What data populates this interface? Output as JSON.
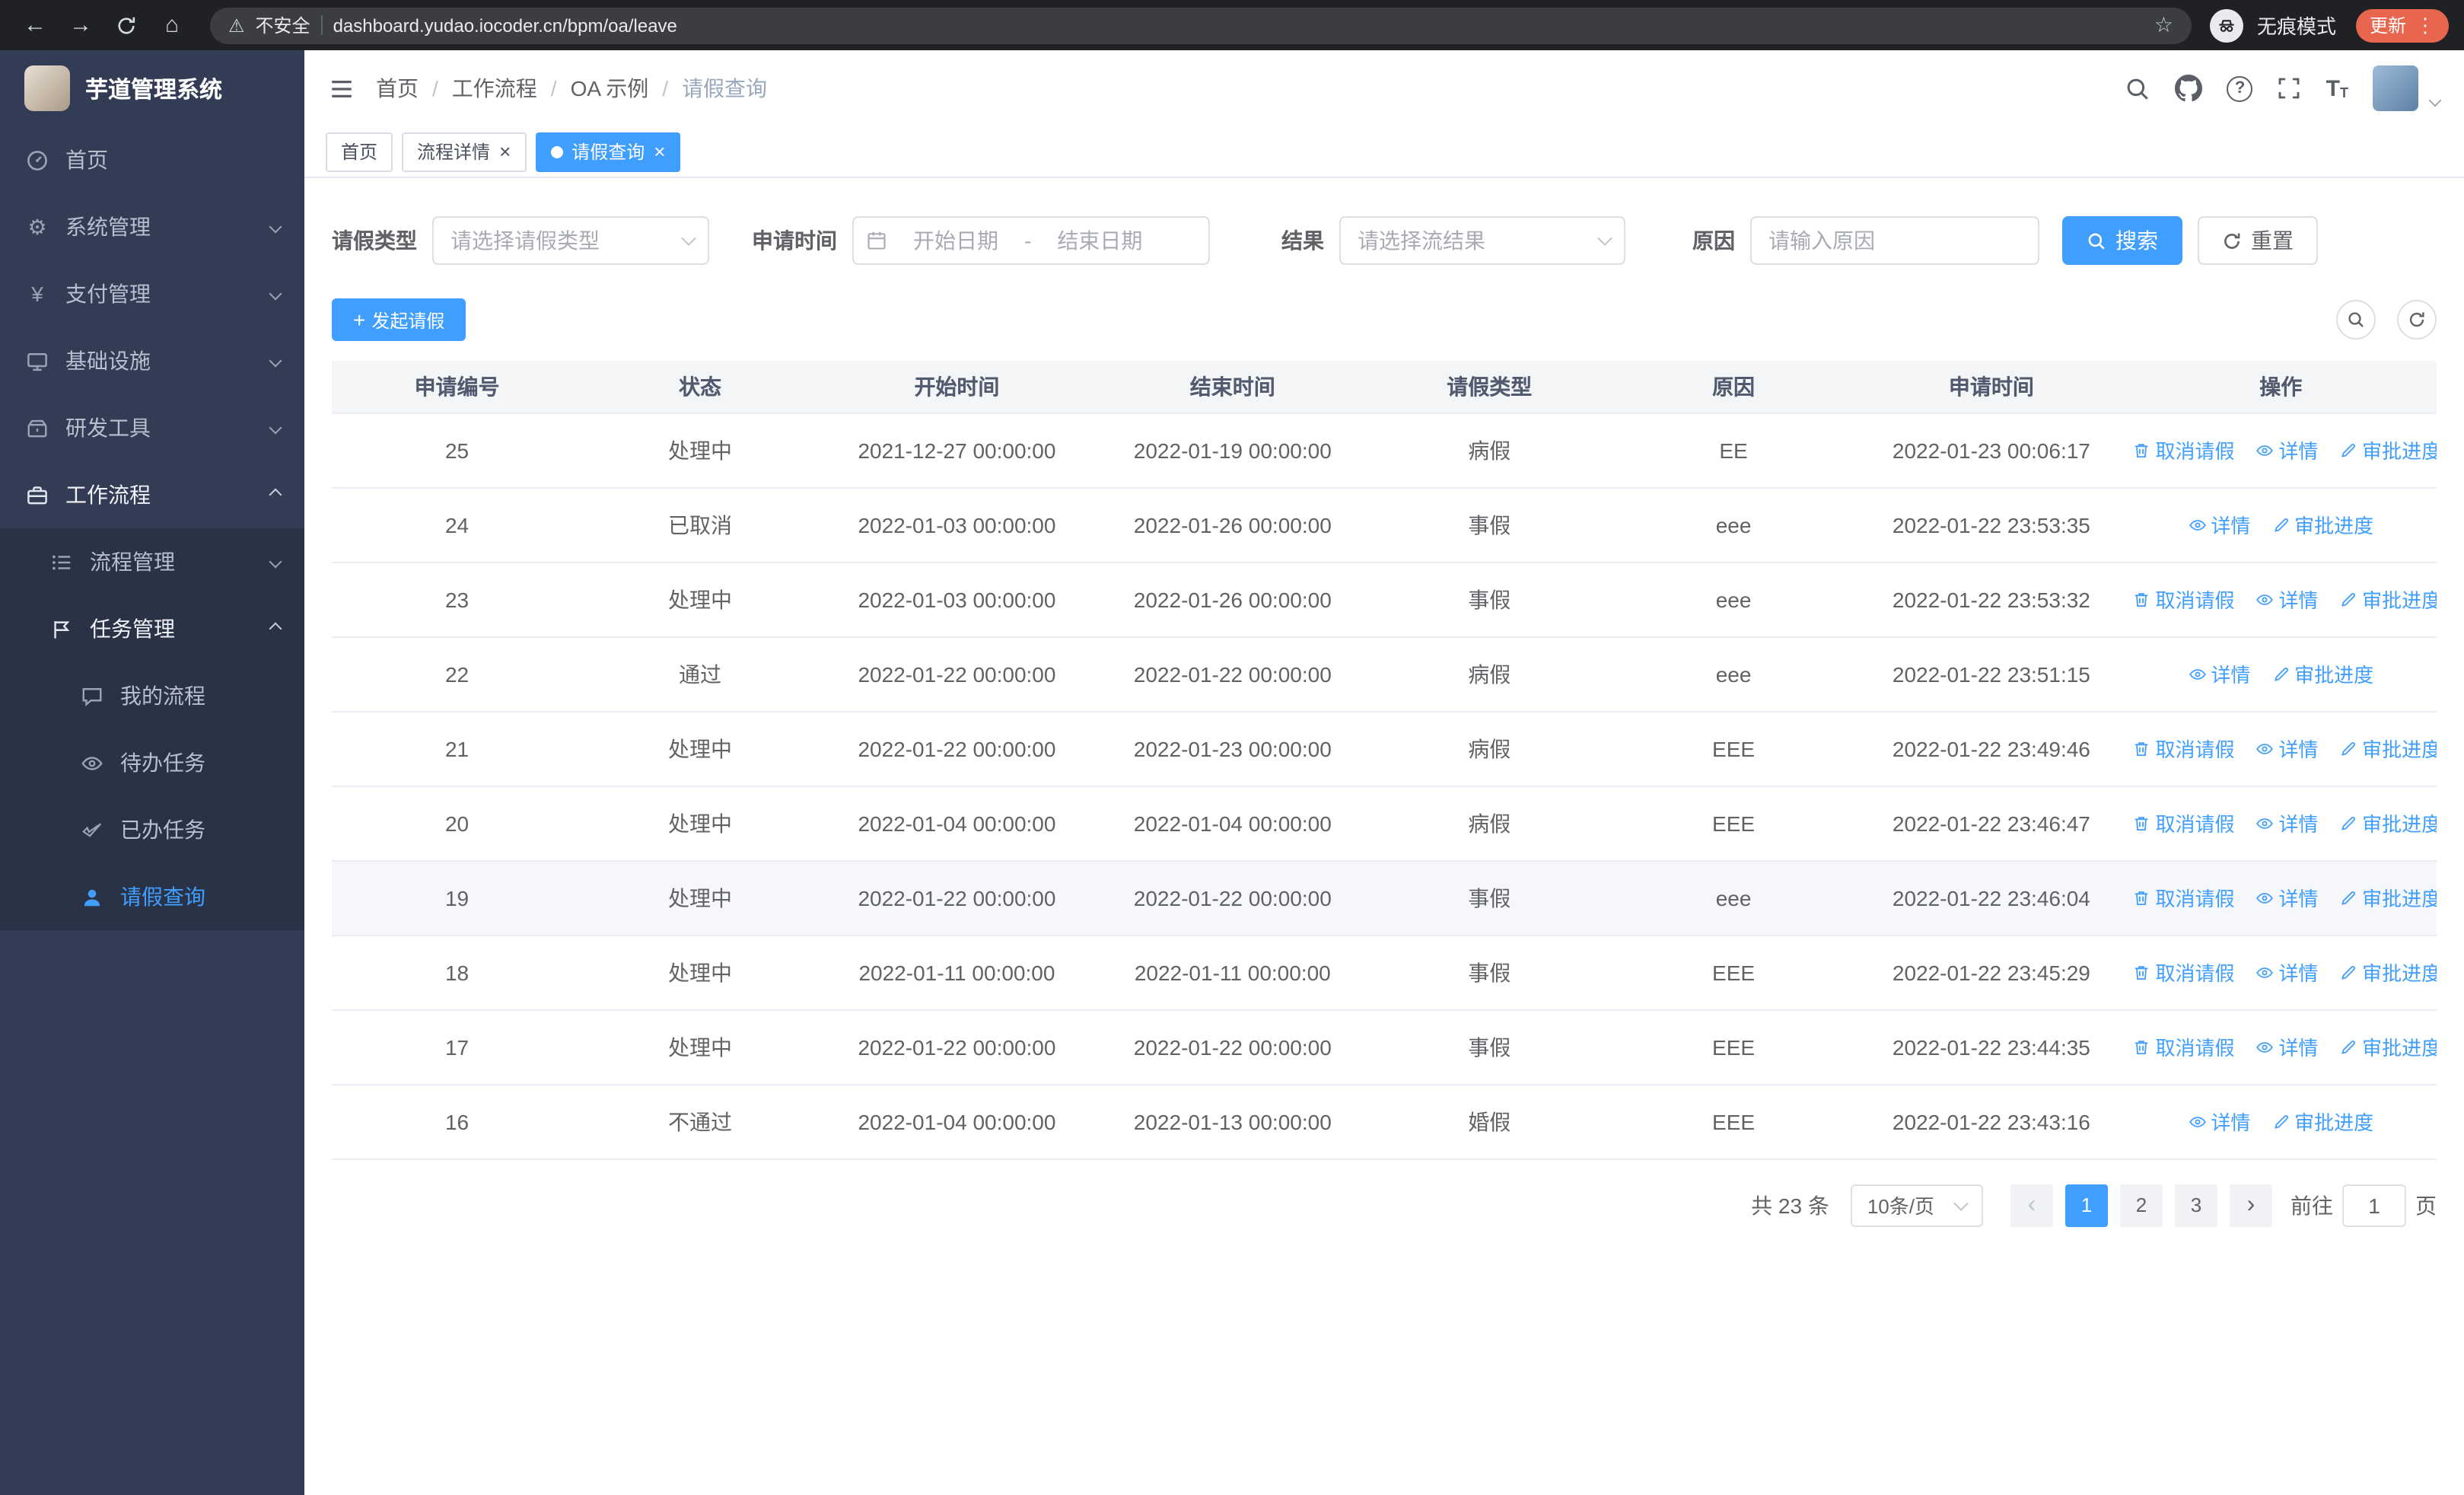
{
  "browser": {
    "security_label": "不安全",
    "url": "dashboard.yudao.iocoder.cn/bpm/oa/leave",
    "incognito_label": "无痕模式",
    "update_label": "更新"
  },
  "glyphs": {
    "back": "←",
    "forward": "→",
    "home": "⌂",
    "warning": "⚠",
    "star": "☆",
    "kebab": "⋮",
    "gear": "⚙",
    "yen": "¥",
    "plus": "+",
    "prev": "‹",
    "next": "›",
    "close": "×",
    "question": "?",
    "font_large": "T",
    "font_small": "T"
  },
  "sidebar": {
    "app_title": "芋道管理系统",
    "items": [
      {
        "label": "首页"
      },
      {
        "label": "系统管理"
      },
      {
        "label": "支付管理"
      },
      {
        "label": "基础设施"
      },
      {
        "label": "研发工具"
      },
      {
        "label": "工作流程"
      }
    ],
    "process_children": [
      {
        "label": "流程管理"
      },
      {
        "label": "任务管理"
      }
    ],
    "task_children": [
      {
        "label": "我的流程"
      },
      {
        "label": "待办任务"
      },
      {
        "label": "已办任务"
      },
      {
        "label": "请假查询"
      }
    ]
  },
  "header": {
    "breadcrumb": [
      "首页",
      "工作流程",
      "OA 示例",
      "请假查询"
    ],
    "separator": "/"
  },
  "tabs": [
    {
      "label": "首页",
      "closable": false,
      "active": false
    },
    {
      "label": "流程详情",
      "closable": true,
      "active": false
    },
    {
      "label": "请假查询",
      "closable": true,
      "active": true
    }
  ],
  "filters": {
    "leave_type_label": "请假类型",
    "leave_type_placeholder": "请选择请假类型",
    "apply_time_label": "申请时间",
    "start_date_placeholder": "开始日期",
    "range_separator": "-",
    "end_date_placeholder": "结束日期",
    "result_label": "结果",
    "result_placeholder": "请选择流结果",
    "reason_label": "原因",
    "reason_placeholder": "请输入原因",
    "search_label": "搜索",
    "reset_label": "重置"
  },
  "toolbar": {
    "create_label": "发起请假"
  },
  "table": {
    "columns": [
      "申请编号",
      "状态",
      "开始时间",
      "结束时间",
      "请假类型",
      "原因",
      "申请时间",
      "操作"
    ],
    "action_labels": {
      "cancel": "取消请假",
      "detail": "详情",
      "progress": "审批进度"
    },
    "rows": [
      {
        "id": "25",
        "status": "处理中",
        "start": "2021-12-27 00:00:00",
        "end": "2022-01-19 00:00:00",
        "type": "病假",
        "reason": "EE",
        "applied": "2022-01-23 00:06:17",
        "actions": [
          "cancel",
          "detail",
          "progress"
        ],
        "highlighted": false
      },
      {
        "id": "24",
        "status": "已取消",
        "start": "2022-01-03 00:00:00",
        "end": "2022-01-26 00:00:00",
        "type": "事假",
        "reason": "eee",
        "applied": "2022-01-22 23:53:35",
        "actions": [
          "detail",
          "progress"
        ],
        "highlighted": false
      },
      {
        "id": "23",
        "status": "处理中",
        "start": "2022-01-03 00:00:00",
        "end": "2022-01-26 00:00:00",
        "type": "事假",
        "reason": "eee",
        "applied": "2022-01-22 23:53:32",
        "actions": [
          "cancel",
          "detail",
          "progress"
        ],
        "highlighted": false
      },
      {
        "id": "22",
        "status": "通过",
        "start": "2022-01-22 00:00:00",
        "end": "2022-01-22 00:00:00",
        "type": "病假",
        "reason": "eee",
        "applied": "2022-01-22 23:51:15",
        "actions": [
          "detail",
          "progress"
        ],
        "highlighted": false
      },
      {
        "id": "21",
        "status": "处理中",
        "start": "2022-01-22 00:00:00",
        "end": "2022-01-23 00:00:00",
        "type": "病假",
        "reason": "EEE",
        "applied": "2022-01-22 23:49:46",
        "actions": [
          "cancel",
          "detail",
          "progress"
        ],
        "highlighted": false
      },
      {
        "id": "20",
        "status": "处理中",
        "start": "2022-01-04 00:00:00",
        "end": "2022-01-04 00:00:00",
        "type": "病假",
        "reason": "EEE",
        "applied": "2022-01-22 23:46:47",
        "actions": [
          "cancel",
          "detail",
          "progress"
        ],
        "highlighted": false
      },
      {
        "id": "19",
        "status": "处理中",
        "start": "2022-01-22 00:00:00",
        "end": "2022-01-22 00:00:00",
        "type": "事假",
        "reason": "eee",
        "applied": "2022-01-22 23:46:04",
        "actions": [
          "cancel",
          "detail",
          "progress"
        ],
        "highlighted": true
      },
      {
        "id": "18",
        "status": "处理中",
        "start": "2022-01-11 00:00:00",
        "end": "2022-01-11 00:00:00",
        "type": "事假",
        "reason": "EEE",
        "applied": "2022-01-22 23:45:29",
        "actions": [
          "cancel",
          "detail",
          "progress"
        ],
        "highlighted": false
      },
      {
        "id": "17",
        "status": "处理中",
        "start": "2022-01-22 00:00:00",
        "end": "2022-01-22 00:00:00",
        "type": "事假",
        "reason": "EEE",
        "applied": "2022-01-22 23:44:35",
        "actions": [
          "cancel",
          "detail",
          "progress"
        ],
        "highlighted": false
      },
      {
        "id": "16",
        "status": "不通过",
        "start": "2022-01-04 00:00:00",
        "end": "2022-01-13 00:00:00",
        "type": "婚假",
        "reason": "EEE",
        "applied": "2022-01-22 23:43:16",
        "actions": [
          "detail",
          "progress"
        ],
        "highlighted": false
      }
    ]
  },
  "pagination": {
    "total_label": "共 23 条",
    "page_size_label": "10条/页",
    "pages": [
      "1",
      "2",
      "3"
    ],
    "active_page": "1",
    "goto_label": "前往",
    "goto_value": "1",
    "unit_label": "页"
  },
  "colors": {
    "primary": "#409eff",
    "sidebar_bg": "#333c55",
    "submenu_bg": "#2a3246",
    "chrome_bg": "#202124",
    "update_pill": "#e8664d",
    "table_header_bg": "#f4f5f7"
  }
}
